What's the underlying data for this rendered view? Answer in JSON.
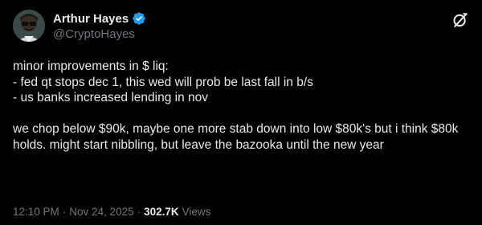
{
  "author": {
    "display_name": "Arthur Hayes",
    "handle": "@CryptoHayes",
    "verified_icon": "verified-badge-icon",
    "avatar_icon": "avatar-icon"
  },
  "platform_icon": "x-logo-icon",
  "tweet": {
    "lines": [
      "minor improvements in $ liq:",
      "- fed qt stops dec 1, this wed will prob be last fall in b/s",
      "- us banks increased lending in nov",
      "",
      "we chop below $90k, maybe one more stab down into low $80k's but i think $80k holds. might start nibbling, but leave the bazooka until the new year"
    ]
  },
  "meta": {
    "time": "12:10 PM",
    "date": "Nov 24, 2025",
    "separator": "·",
    "views_count": "302.7K",
    "views_label": "Views"
  },
  "colors": {
    "background": "#000000",
    "text_primary": "#e7e9ea",
    "text_secondary": "#71767b",
    "verified_blue": "#1d9bf0"
  }
}
